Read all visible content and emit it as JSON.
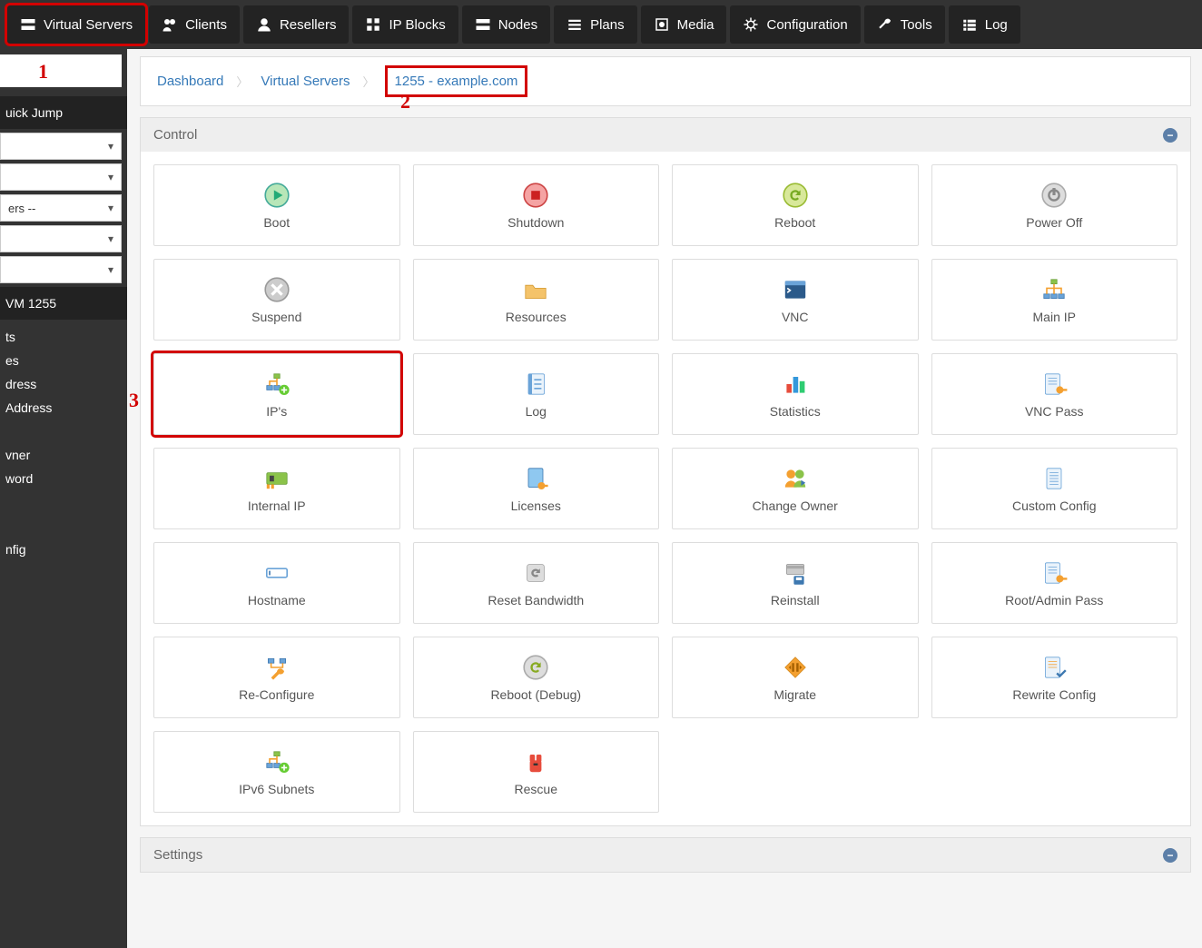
{
  "topnav": [
    {
      "label": "Virtual Servers",
      "icon": "servers"
    },
    {
      "label": "Clients",
      "icon": "users"
    },
    {
      "label": "Resellers",
      "icon": "user"
    },
    {
      "label": "IP Blocks",
      "icon": "grid"
    },
    {
      "label": "Nodes",
      "icon": "servers"
    },
    {
      "label": "Plans",
      "icon": "list"
    },
    {
      "label": "Media",
      "icon": "disc"
    },
    {
      "label": "Configuration",
      "icon": "gear"
    },
    {
      "label": "Tools",
      "icon": "wrench"
    },
    {
      "label": "Log",
      "icon": "bars"
    }
  ],
  "markers": {
    "m1": "1",
    "m2": "2",
    "m3": "3"
  },
  "sidebar": {
    "quickjump": "uick Jump",
    "dd3": "ers --",
    "vm": "VM 1255",
    "links": [
      "ts",
      "es",
      "dress",
      "Address",
      "",
      "vner",
      "word",
      "",
      "",
      "nfig",
      ""
    ]
  },
  "breadcrumb": {
    "dashboard": "Dashboard",
    "vs": "Virtual Servers",
    "cur": "1255 - example.com"
  },
  "panel_control": "Control",
  "panel_settings": "Settings",
  "cards": [
    {
      "label": "Boot",
      "icon": "play"
    },
    {
      "label": "Shutdown",
      "icon": "stop"
    },
    {
      "label": "Reboot",
      "icon": "refresh-g"
    },
    {
      "label": "Power Off",
      "icon": "power-grey"
    },
    {
      "label": "Suspend",
      "icon": "x-grey"
    },
    {
      "label": "Resources",
      "icon": "folder"
    },
    {
      "label": "VNC",
      "icon": "terminal"
    },
    {
      "label": "Main IP",
      "icon": "net"
    },
    {
      "label": "IP's",
      "icon": "net-plus"
    },
    {
      "label": "Log",
      "icon": "notebook"
    },
    {
      "label": "Statistics",
      "icon": "bars-c"
    },
    {
      "label": "VNC Pass",
      "icon": "doc-key"
    },
    {
      "label": "Internal IP",
      "icon": "nic"
    },
    {
      "label": "Licenses",
      "icon": "doc-key2"
    },
    {
      "label": "Change Owner",
      "icon": "people"
    },
    {
      "label": "Custom Config",
      "icon": "doc-lines"
    },
    {
      "label": "Hostname",
      "icon": "field"
    },
    {
      "label": "Reset Bandwidth",
      "icon": "reset-g"
    },
    {
      "label": "Reinstall",
      "icon": "server-save"
    },
    {
      "label": "Root/Admin Pass",
      "icon": "doc-key3"
    },
    {
      "label": "Re-Configure",
      "icon": "net-wrench"
    },
    {
      "label": "Reboot (Debug)",
      "icon": "refresh-grey"
    },
    {
      "label": "Migrate",
      "icon": "diamond"
    },
    {
      "label": "Rewrite Config",
      "icon": "doc-check"
    },
    {
      "label": "IPv6 Subnets",
      "icon": "net-plus2"
    },
    {
      "label": "Rescue",
      "icon": "lifevest"
    }
  ]
}
